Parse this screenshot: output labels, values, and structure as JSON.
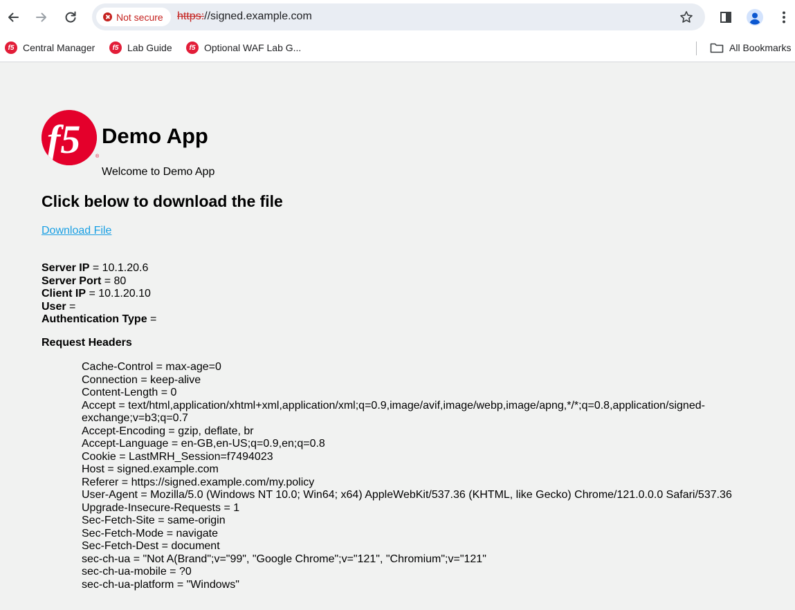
{
  "browser": {
    "security_chip": "Not secure",
    "url_scheme": "https:",
    "url_rest": "//signed.example.com",
    "bookmarks": [
      "Central Manager",
      "Lab Guide",
      "Optional WAF Lab G..."
    ],
    "all_bookmarks": "All Bookmarks",
    "colors": {
      "insecure_red": "#c5221f",
      "omnibox_bg": "#e9edf3",
      "f5_red": "#e4002b"
    }
  },
  "app": {
    "logo_text": "f5",
    "logo_reg_mark": "®",
    "title": "Demo App",
    "welcome": "Welcome to Demo App",
    "section_title": "Click below to download the file",
    "download_link": "Download File"
  },
  "server_info": {
    "server_ip_label": "Server IP",
    "server_ip": "10.1.20.6",
    "server_port_label": "Server Port",
    "server_port": "80",
    "client_ip_label": "Client IP",
    "client_ip": "10.1.20.10",
    "user_label": "User",
    "user": "",
    "auth_type_label": "Authentication Type",
    "auth_type": ""
  },
  "request_headers_title": "Request Headers",
  "request_headers": [
    "Cache-Control = max-age=0",
    "Connection = keep-alive",
    "Content-Length = 0",
    "Accept = text/html,application/xhtml+xml,application/xml;q=0.9,image/avif,image/webp,image/apng,*/*;q=0.8,application/signed-",
    "exchange;v=b3;q=0.7",
    "Accept-Encoding = gzip, deflate, br",
    "Accept-Language = en-GB,en-US;q=0.9,en;q=0.8",
    "Cookie = LastMRH_Session=f7494023",
    "Host = signed.example.com",
    "Referer = https://signed.example.com/my.policy",
    "User-Agent = Mozilla/5.0 (Windows NT 10.0; Win64; x64) AppleWebKit/537.36 (KHTML, like Gecko) Chrome/121.0.0.0 Safari/537.36",
    "Upgrade-Insecure-Requests = 1",
    "Sec-Fetch-Site = same-origin",
    "Sec-Fetch-Mode = navigate",
    "Sec-Fetch-Dest = document",
    "sec-ch-ua = \"Not A(Brand\";v=\"99\", \"Google Chrome\";v=\"121\", \"Chromium\";v=\"121\"",
    "sec-ch-ua-mobile = ?0",
    "sec-ch-ua-platform = \"Windows\""
  ]
}
